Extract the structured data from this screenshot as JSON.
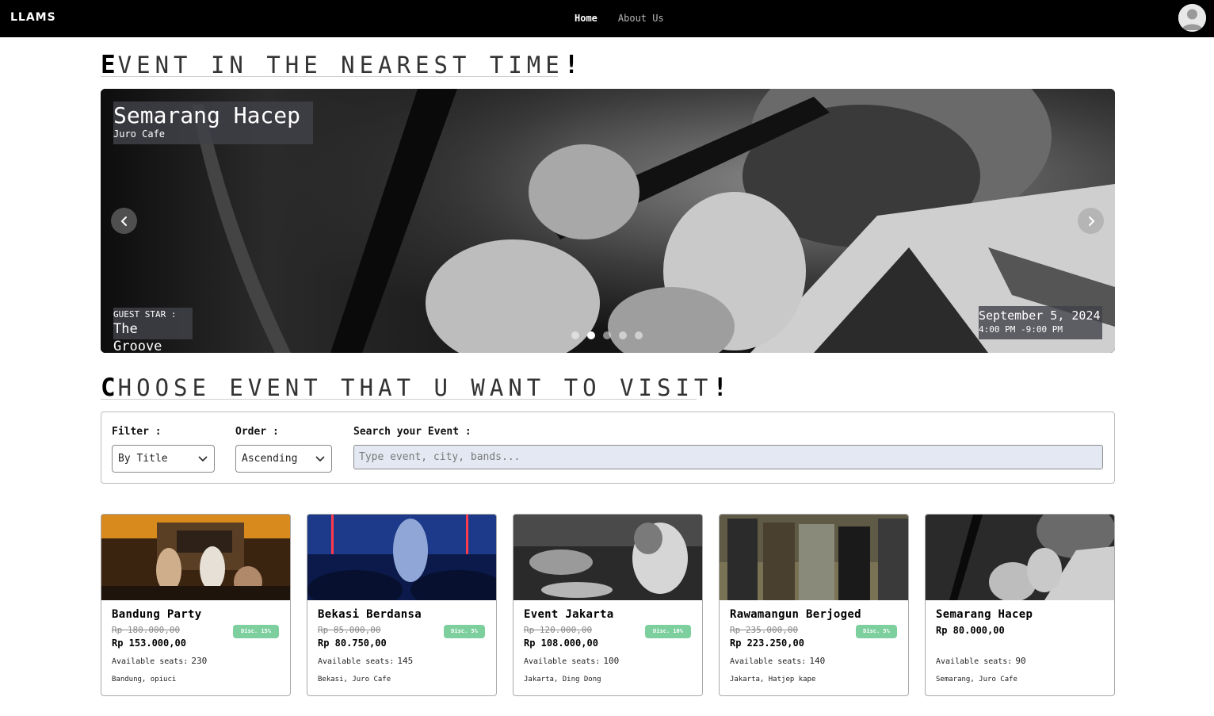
{
  "navbar": {
    "logo": "LLAMS",
    "links": [
      {
        "label": "Home",
        "active": true
      },
      {
        "label": "About Us",
        "active": false
      }
    ]
  },
  "section1": {
    "first": "E",
    "rest": "VENT IN THE NEAREST TIME",
    "bang": "!"
  },
  "carousel": {
    "title": "Semarang Hacep",
    "venue": "Juro Cafe",
    "guest_label": "GUEST STAR :",
    "guest_name": "The Groove",
    "date": "September 5, 2024",
    "time": "4:00 PM -9:00 PM",
    "slides_count": 5,
    "active_slide": 1
  },
  "section2": {
    "first": "C",
    "rest": "HOOSE EVENT THAT U WANT TO VISIT",
    "bang": "!"
  },
  "filters": {
    "filter_label": "Filter :",
    "filter_value": "By Title",
    "order_label": "Order :",
    "order_value": "Ascending",
    "search_label": "Search your Event :",
    "search_placeholder": "Type event, city, bands..."
  },
  "events": [
    {
      "title": "Bandung Party",
      "old_price": "Rp 180.000,00",
      "price": "Rp 153.000,00",
      "discount": "Disc. 15%",
      "seats_label": "Available seats:",
      "seats": "230",
      "location": "Bandung, opiuci",
      "image": "concert-stage-warm"
    },
    {
      "title": "Bekasi Berdansa",
      "old_price": "Rp 85.000,00",
      "price": "Rp 80.750,00",
      "discount": "Disc. 5%",
      "seats_label": "Available seats:",
      "seats": "145",
      "location": "Bekasi, Juro Cafe",
      "image": "concert-crowd-blue"
    },
    {
      "title": "Event Jakarta",
      "old_price": "Rp 120.000,00",
      "price": "Rp 108.000,00",
      "discount": "Disc. 10%",
      "seats_label": "Available seats:",
      "seats": "100",
      "location": "Jakarta, Ding Dong",
      "image": "singer-bw"
    },
    {
      "title": "Rawamangun Berjoged",
      "old_price": "Rp 235.000,00",
      "price": "Rp 223.250,00",
      "discount": "Disc. 5%",
      "seats_label": "Available seats:",
      "seats": "140",
      "location": "Jakarta, Hatjep kape",
      "image": "band-field"
    },
    {
      "title": "Semarang Hacep",
      "old_price": "",
      "price": "Rp 80.000,00",
      "discount": "",
      "seats_label": "Available seats:",
      "seats": "90",
      "location": "Semarang, Juro Cafe",
      "image": "singer-mic-bw"
    }
  ],
  "colors": {
    "navbar": "#000000",
    "discount_badge": "#7dcf9e",
    "search_bg": "#e3e8f2"
  }
}
